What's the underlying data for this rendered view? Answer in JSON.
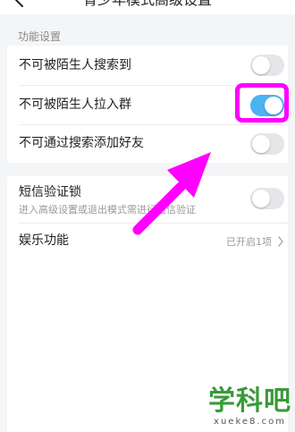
{
  "header": {
    "title": "青少年模式高级设置"
  },
  "section": {
    "title": "功能设置"
  },
  "settings": [
    {
      "label": "不可被陌生人搜索到",
      "enabled": false
    },
    {
      "label": "不可被陌生人拉入群",
      "enabled": true
    },
    {
      "label": "不可通过搜索添加好友",
      "enabled": false
    },
    {
      "label": "短信验证锁",
      "subtitle": "进入高级设置或退出模式需进行短信验证",
      "enabled": false
    }
  ],
  "entertainment": {
    "label": "娱乐功能",
    "value": "已开启1项"
  },
  "watermark": {
    "main": "学科吧",
    "sub": "xueke8.com"
  },
  "colors": {
    "toggle_on": "#4ab3f0",
    "toggle_off": "#e6e6ea",
    "highlight": "#ff00ff",
    "watermark": "#3a9a3a"
  }
}
